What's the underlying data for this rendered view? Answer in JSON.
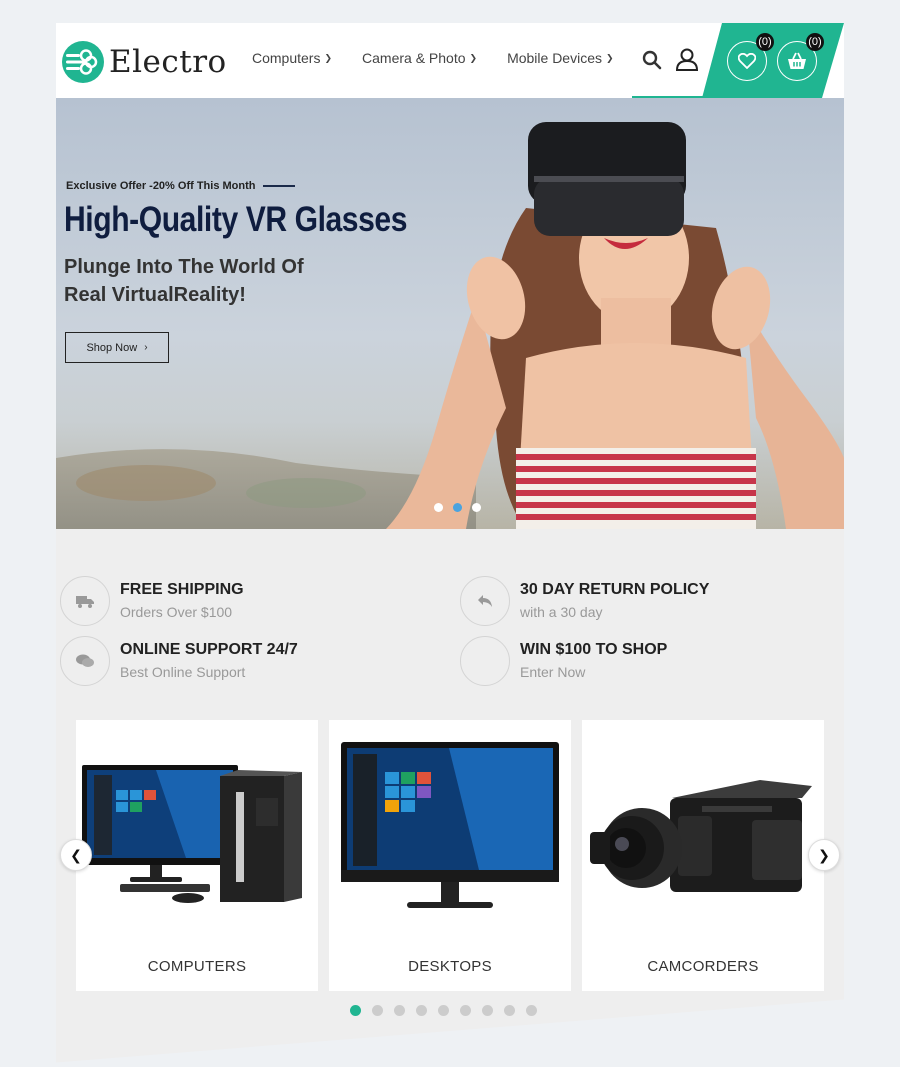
{
  "header": {
    "logo_text": "Electro",
    "nav": [
      {
        "label": "Computers"
      },
      {
        "label": "Camera & Photo"
      },
      {
        "label": "Mobile Devices"
      }
    ],
    "wishlist_count": "(0)",
    "cart_count": "(0)",
    "icons": [
      "search-icon",
      "user-icon",
      "heart-icon",
      "basket-icon"
    ],
    "accent_color": "#20b591"
  },
  "hero": {
    "eyebrow": "Exclusive Offer -20% Off This Month",
    "title": "High-Quality VR Glasses",
    "subtitle_line1": "Plunge Into The World Of",
    "subtitle_line2": "Real VirtualReality!",
    "button_label": "Shop Now",
    "slides": 3,
    "active_slide": 2
  },
  "features": [
    {
      "title": "FREE SHIPPING",
      "subtitle": "Orders Over $100",
      "icon": "truck-icon"
    },
    {
      "title": "30 DAY RETURN POLICY",
      "subtitle": "with a 30 day",
      "icon": "return-icon"
    },
    {
      "title": "ONLINE SUPPORT 24/7",
      "subtitle": "Best Online Support",
      "icon": "chat-icon"
    },
    {
      "title": "WIN $100 TO SHOP",
      "subtitle": "Enter Now",
      "icon": "gift-icon"
    }
  ],
  "categories": [
    {
      "label": "COMPUTERS"
    },
    {
      "label": "DESKTOPS"
    },
    {
      "label": "CAMCORDERS"
    }
  ],
  "carousel": {
    "prev_icon": "chevron-left-icon",
    "next_icon": "chevron-right-icon",
    "dots": 9,
    "active_dot": 1
  }
}
